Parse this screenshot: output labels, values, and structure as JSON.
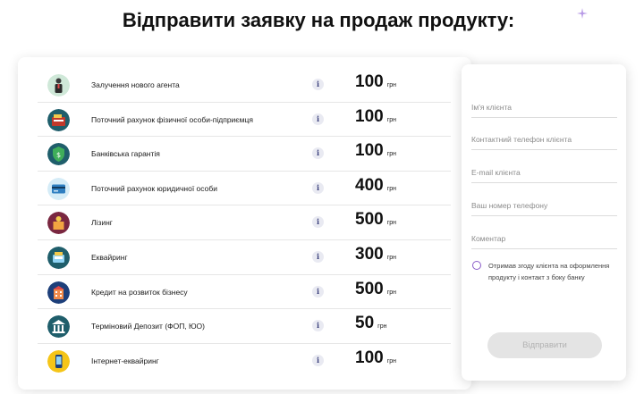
{
  "page": {
    "title": "Відправити заявку на продаж продукту:"
  },
  "products": [
    {
      "name": "Залучення нового агента",
      "price": "100",
      "currency": "грн",
      "icon": "agent-person-icon"
    },
    {
      "name": "Поточний рахунок фізичної особи-підприємця",
      "price": "100",
      "currency": "грн",
      "icon": "cash-register-icon"
    },
    {
      "name": "Банківська гарантія",
      "price": "100",
      "currency": "грн",
      "icon": "shield-dollar-icon"
    },
    {
      "name": "Поточний рахунок юридичної особи",
      "price": "400",
      "currency": "грн",
      "icon": "card-icon"
    },
    {
      "name": "Лізинг",
      "price": "500",
      "currency": "грн",
      "icon": "box-coin-icon"
    },
    {
      "name": "Еквайринг",
      "price": "300",
      "currency": "грн",
      "icon": "terminal-icon"
    },
    {
      "name": "Кредит на розвиток бізнесу",
      "price": "500",
      "currency": "грн",
      "icon": "building-icon"
    },
    {
      "name": "Терміновий Депозит (ФОП, ЮО)",
      "price": "50",
      "currency": "грн",
      "icon": "bank-icon"
    },
    {
      "name": "Інтернет-еквайринг",
      "price": "100",
      "currency": "грн",
      "icon": "phone-pay-icon"
    }
  ],
  "info_glyph": "i",
  "form": {
    "client_name_placeholder": "Ім'я клієнта",
    "client_phone_placeholder": "Контактний телефон клієнта",
    "client_email_placeholder": "E-mail клієнта",
    "your_phone_placeholder": "Ваш номер телефону",
    "comment_placeholder": "Коментар",
    "consent_text": "Отримав згоду клієнта на оформлення продукту і контакт з боку банку",
    "submit_label": "Відправити"
  },
  "colors": {
    "accent": "#8a5cc9",
    "icon_bg": "#1f5e6b",
    "submit_bg": "#e4e4e4"
  }
}
